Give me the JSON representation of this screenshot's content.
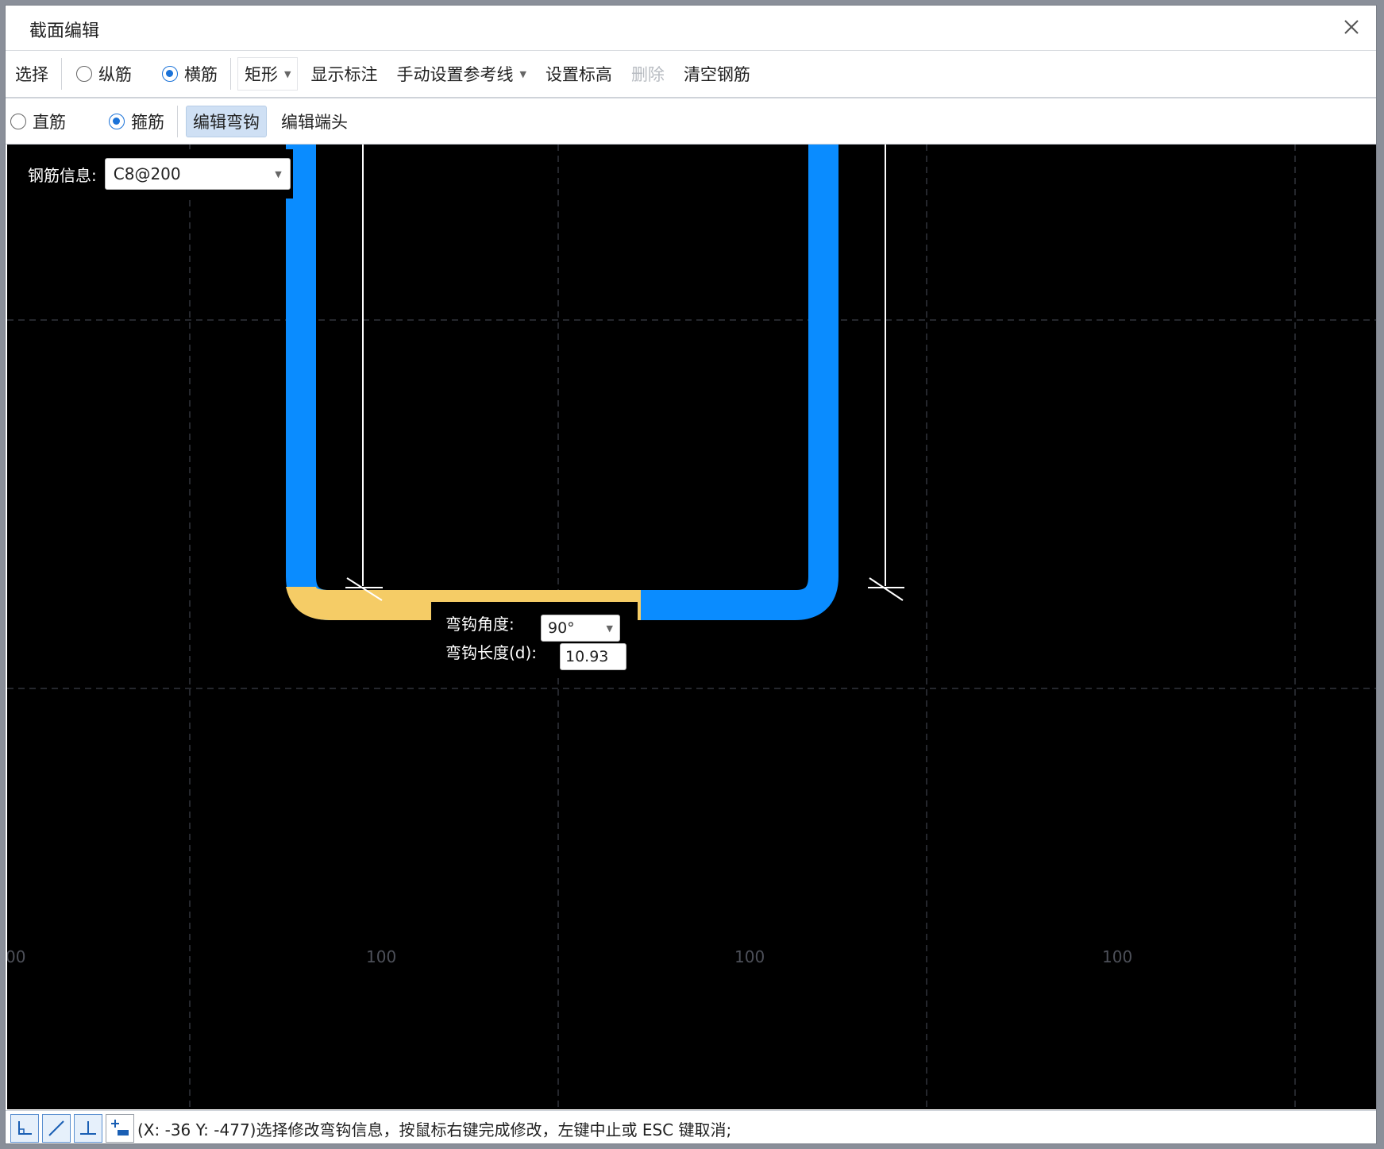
{
  "window": {
    "title": "截面编辑"
  },
  "toolbar1": {
    "select_label": "选择",
    "radio_longitudinal": "纵筋",
    "radio_transverse": "横筋",
    "shape_label": "矩形",
    "show_annotation": "显示标注",
    "manual_refline": "手动设置参考线",
    "set_elevation": "设置标高",
    "delete": "删除",
    "clear_rebar": "清空钢筋"
  },
  "toolbar2": {
    "radio_straight": "直筋",
    "radio_stirrup": "箍筋",
    "edit_hook": "编辑弯钩",
    "edit_end": "编辑端头"
  },
  "rebar_info": {
    "label": "钢筋信息:",
    "value": "C8@200"
  },
  "hook_editor": {
    "angle_label": "弯钩角度:",
    "angle_value": "90°",
    "length_label": "弯钩长度(d):",
    "length_value": "10.93"
  },
  "canvas": {
    "scale_labels": [
      "00",
      "100",
      "100",
      "100"
    ],
    "colors": {
      "rebar": "#0a8cff",
      "hook_selected": "#f5cc66",
      "grid": "#4a4e5a",
      "refline": "#ffffff",
      "background": "#000000"
    }
  },
  "status": {
    "text": "(X: -36 Y: -477)选择修改弯钩信息，按鼠标右键完成修改，左键中止或 ESC 键取消;",
    "snap_icons": [
      "corner-snap-icon",
      "diagonal-snap-icon",
      "perpendicular-snap-icon",
      "add-point-icon"
    ]
  }
}
